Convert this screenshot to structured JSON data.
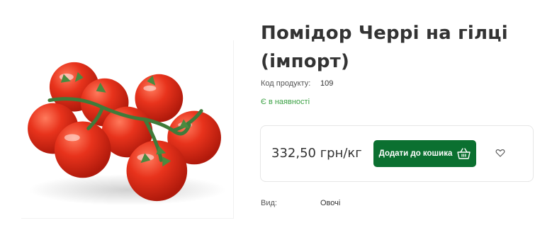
{
  "product": {
    "title": "Помідор Черрі на гілці (імпорт)",
    "code_label": "Код продукту:",
    "code_value": "109",
    "stock_status": "Є в наявності",
    "price": "332,50 грн/кг",
    "add_to_cart_label": "Додати до кошика",
    "attributes": [
      {
        "label": "Вид:",
        "value": "Овочі"
      }
    ]
  },
  "icons": {
    "cart": "shopping-basket-icon",
    "wishlist": "heart-icon"
  },
  "colors": {
    "primary_button": "#0b7030",
    "in_stock": "#3aa043",
    "text": "#333333",
    "border": "#e6e6e6"
  }
}
